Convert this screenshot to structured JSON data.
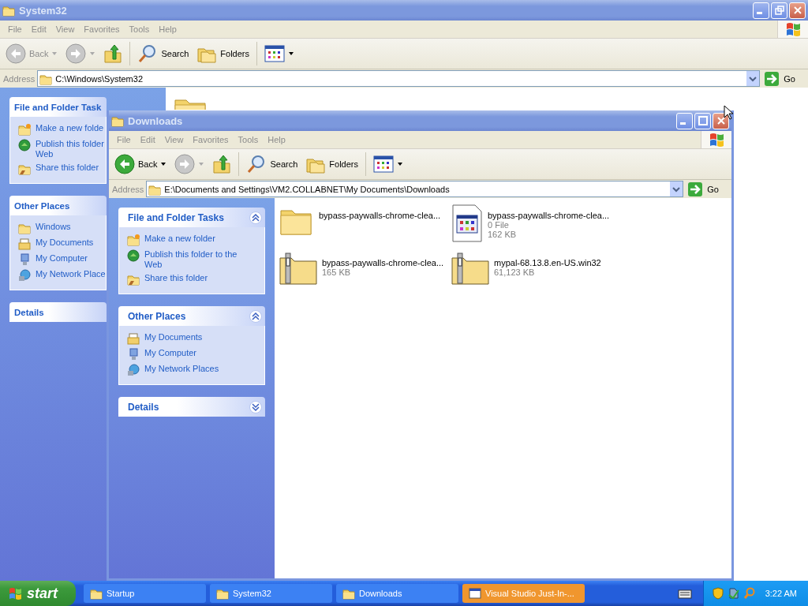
{
  "windows": [
    {
      "title": "System32",
      "active": false,
      "maximized": true,
      "menu": [
        "File",
        "Edit",
        "View",
        "Favorites",
        "Tools",
        "Help"
      ],
      "toolbar": {
        "back": {
          "label": "Back",
          "disabled": true
        },
        "forward": {
          "disabled": true
        },
        "search": "Search",
        "folders": "Folders"
      },
      "address": {
        "label": "Address",
        "value": "C:\\Windows\\System32"
      },
      "go": "Go",
      "task_panels": [
        {
          "title": "File and Folder Task",
          "expanded": true,
          "items": [
            {
              "kind": "newfolder",
              "lines": [
                "Make a new folde"
              ]
            },
            {
              "kind": "globe",
              "lines": [
                "Publish this folder",
                "Web"
              ]
            },
            {
              "kind": "share",
              "lines": [
                "Share this folder"
              ]
            }
          ]
        },
        {
          "title": "Other Places",
          "expanded": true,
          "items": [
            {
              "kind": "folder",
              "lines": [
                "Windows"
              ]
            },
            {
              "kind": "documents",
              "lines": [
                "My Documents"
              ]
            },
            {
              "kind": "computer",
              "lines": [
                "My Computer"
              ]
            },
            {
              "kind": "network",
              "lines": [
                "My Network Place"
              ]
            }
          ]
        },
        {
          "title": "Details",
          "expanded": false
        }
      ],
      "files": [
        {
          "kind": "folder"
        }
      ]
    },
    {
      "title": "Downloads",
      "active": false,
      "maximized": false,
      "menu": [
        "File",
        "Edit",
        "View",
        "Favorites",
        "Tools",
        "Help"
      ],
      "toolbar": {
        "back": {
          "label": "Back",
          "disabled": false
        },
        "forward": {
          "disabled": true
        },
        "search": "Search",
        "folders": "Folders"
      },
      "address": {
        "label": "Address",
        "value": "E:\\Documents and Settings\\VM2.COLLABNET\\My Documents\\Downloads"
      },
      "go": "Go",
      "task_panels": [
        {
          "title": "File and Folder Tasks",
          "expanded": true,
          "items": [
            {
              "kind": "newfolder",
              "lines": [
                "Make a new folder"
              ]
            },
            {
              "kind": "globe",
              "lines": [
                "Publish this folder to the Web"
              ]
            },
            {
              "kind": "share",
              "lines": [
                "Share this folder"
              ]
            }
          ]
        },
        {
          "title": "Other Places",
          "expanded": true,
          "items": [
            {
              "kind": "documents",
              "lines": [
                "My Documents"
              ]
            },
            {
              "kind": "computer",
              "lines": [
                "My Computer"
              ]
            },
            {
              "kind": "network",
              "lines": [
                "My Network Places"
              ]
            }
          ]
        },
        {
          "title": "Details",
          "expanded": false
        }
      ],
      "files": [
        {
          "kind": "folder",
          "name": "bypass-paywalls-chrome-clea..."
        },
        {
          "kind": "app",
          "name": "bypass-paywalls-chrome-clea...",
          "details": [
            "0 File",
            "162 KB"
          ]
        },
        {
          "kind": "zip",
          "name": "bypass-paywalls-chrome-clea...",
          "details": [
            "165 KB"
          ]
        },
        {
          "kind": "zip",
          "name": "mypal-68.13.8.en-US.win32",
          "details": [
            "61,123 KB"
          ]
        }
      ]
    }
  ],
  "taskbar": {
    "start": "start",
    "buttons": [
      {
        "label": "Startup",
        "kind": "folder",
        "flashing": false
      },
      {
        "label": "System32",
        "kind": "folder",
        "flashing": false
      },
      {
        "label": "Downloads",
        "kind": "folder",
        "flashing": false
      },
      {
        "label": "Visual Studio Just-In-...",
        "kind": "app",
        "flashing": true
      }
    ],
    "clock": "3:22 AM"
  }
}
